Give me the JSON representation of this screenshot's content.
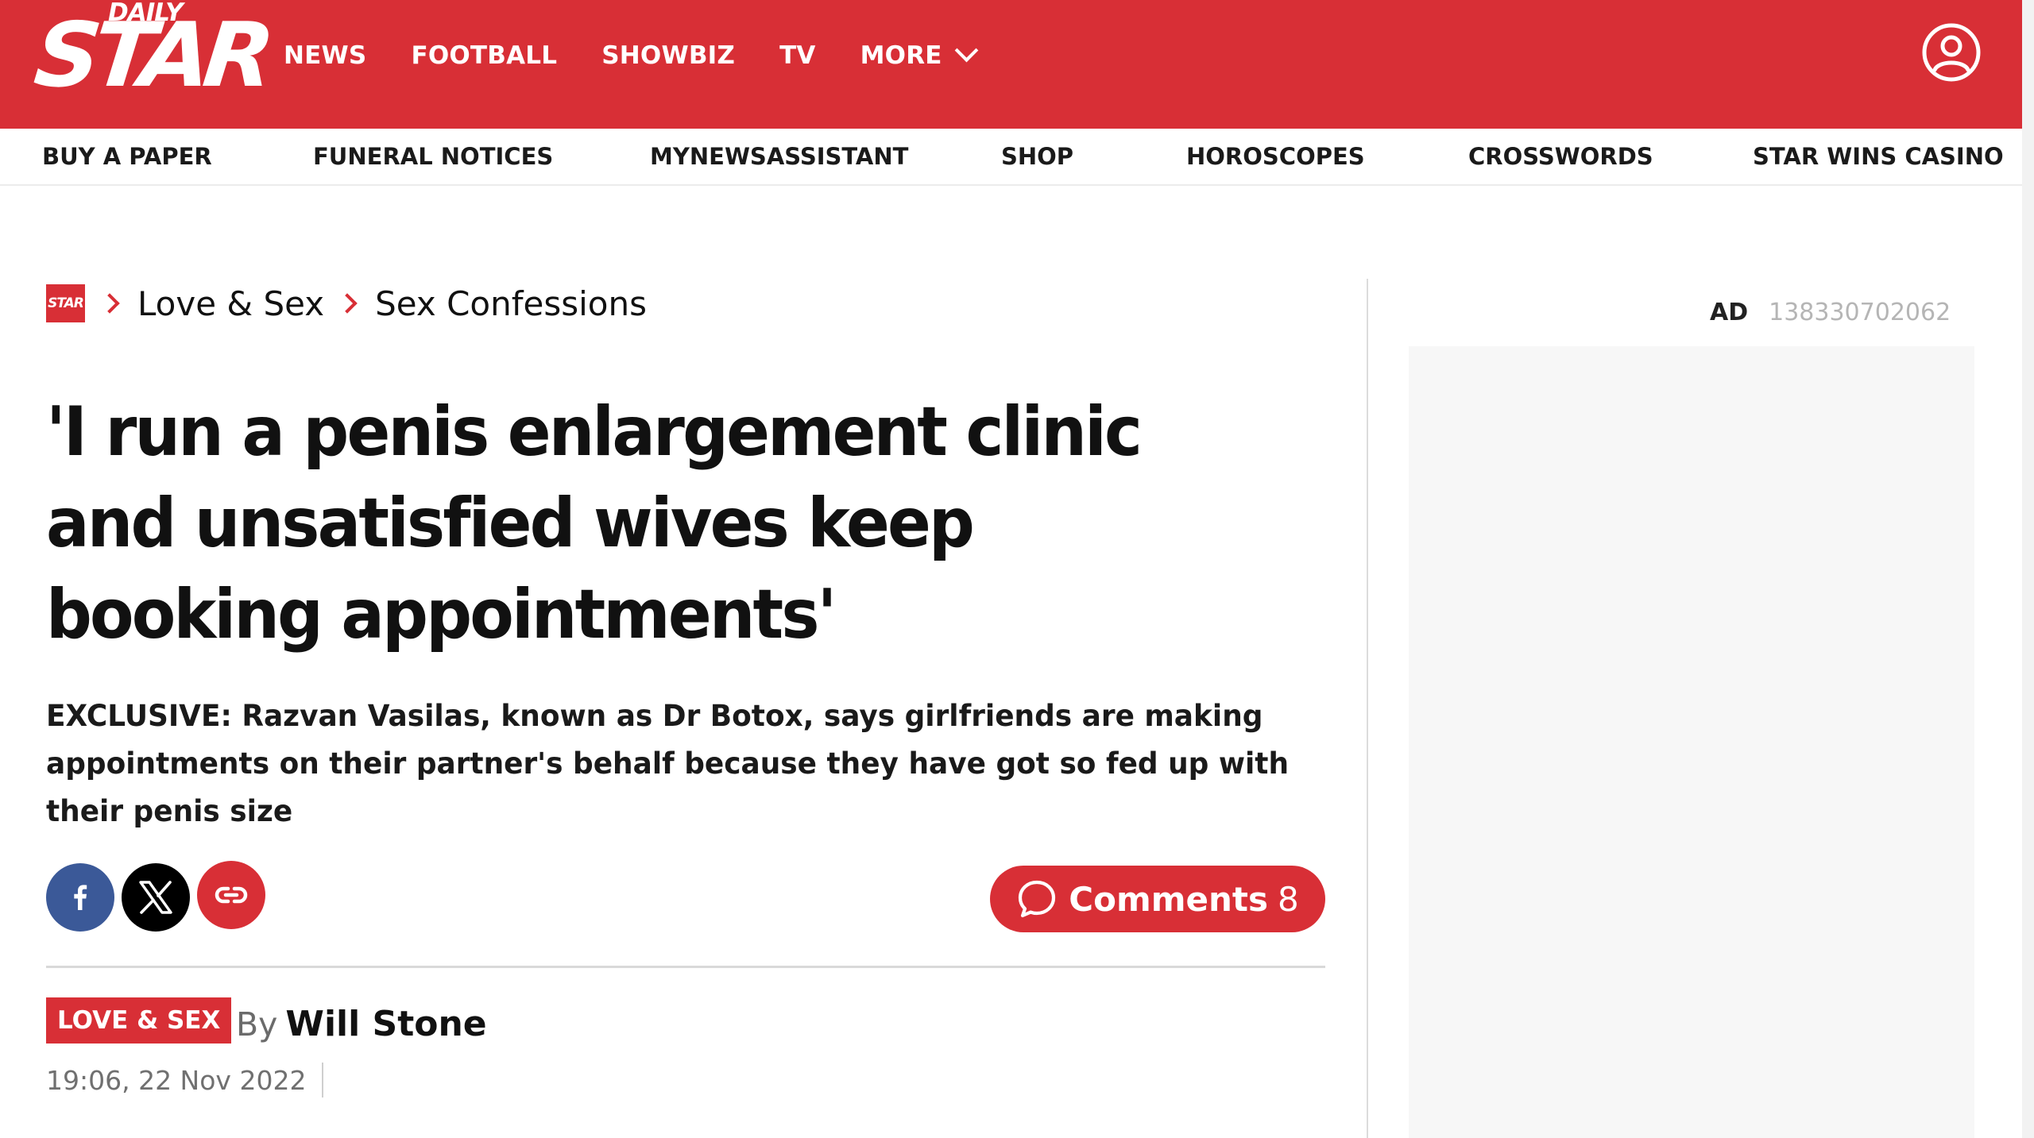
{
  "header": {
    "logo_top": "DAILY",
    "logo_main": "STAR",
    "nav": [
      "NEWS",
      "FOOTBALL",
      "SHOWBIZ",
      "TV",
      "MORE"
    ],
    "account_icon": "user-circle-icon",
    "brand_color": "#d82f36"
  },
  "subnav": [
    "BUY A PAPER",
    "FUNERAL NOTICES",
    "MYNEWSASSISTANT",
    "SHOP",
    "HOROSCOPES",
    "CROSSWORDS",
    "STAR WINS CASINO"
  ],
  "breadcrumb": {
    "home_logo": "STAR",
    "items": [
      "Love & Sex",
      "Sex Confessions"
    ]
  },
  "article": {
    "headline": "'I run a penis enlargement clinic and unsatisfied wives keep booking appointments'",
    "standfirst": "EXCLUSIVE: Razvan Vasilas, known as Dr Botox, says girlfriends are making appointments on their partner's behalf because they have got so fed up with their penis size",
    "share": [
      "facebook-icon",
      "x-icon",
      "link-icon"
    ],
    "comments_label": "Comments",
    "comments_count": "8",
    "tag": "LOVE & SEX",
    "by": "By",
    "author": "Will Stone",
    "timestamp": "19:06, 22 Nov 2022"
  },
  "sidebar": {
    "ad_label": "AD",
    "ad_id": "138330702062"
  }
}
